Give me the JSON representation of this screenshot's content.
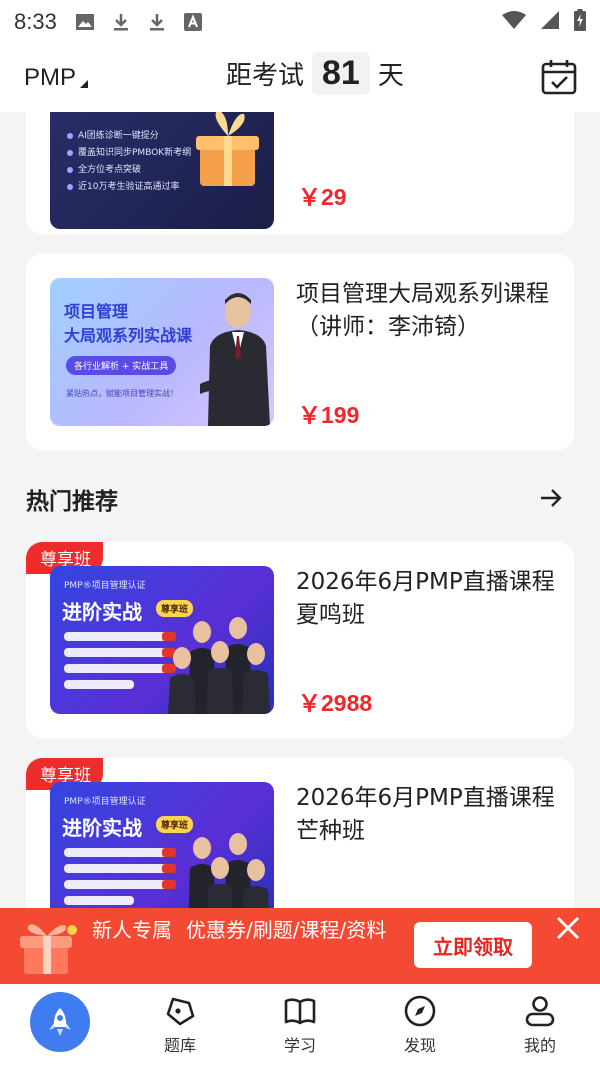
{
  "status_bar": {
    "time": "8:33"
  },
  "header": {
    "exam": "PMP",
    "countdown_prefix": "距考试",
    "countdown_days": "81",
    "countdown_suffix": "天"
  },
  "courses_top": [
    {
      "title": "",
      "price": "￥29",
      "thumb": {
        "bullets": [
          "AI团练诊断一键提分",
          "覆盖知识同步PMBOK新考纲",
          "全方位考点突破",
          "近10万考生验证高通过率"
        ]
      }
    },
    {
      "title": "项目管理大局观系列课程（讲师：李沛锜）",
      "price": "￥199",
      "thumb": {
        "line1": "项目管理",
        "line2": "大局观系列实战课",
        "tag": "各行业解析 + 实战工具",
        "foot": "紧贴热点，赋能项目管理实战！"
      }
    }
  ],
  "hot_section": {
    "title": "热门推荐"
  },
  "hot_courses": [
    {
      "badge": "尊享班",
      "title": "2026年6月PMP直播课程夏鸣班",
      "price": "￥2988",
      "thumb": {
        "top": "PMP®项目管理认证",
        "main": "进阶实战",
        "seal": "尊享班"
      }
    },
    {
      "badge": "尊享班",
      "title": "2026年6月PMP直播课程芒种班",
      "price": "￥2988",
      "thumb": {
        "top": "PMP®项目管理认证",
        "main": "进阶实战",
        "seal": "尊享班"
      }
    }
  ],
  "promo": {
    "text_a": "新人专属",
    "text_b": "优惠券/刷题/课程/资料",
    "button": "立即领取"
  },
  "nav": [
    {
      "label": "",
      "icon": "rocket-icon"
    },
    {
      "label": "题库",
      "icon": "question-bank-icon"
    },
    {
      "label": "学习",
      "icon": "book-icon"
    },
    {
      "label": "发现",
      "icon": "compass-icon"
    },
    {
      "label": "我的",
      "icon": "user-icon"
    }
  ],
  "colors": {
    "price": "#f0262b",
    "badge": "#ee2c2c",
    "promo": "#f44a34",
    "nav_active": "#3f7cf0"
  }
}
